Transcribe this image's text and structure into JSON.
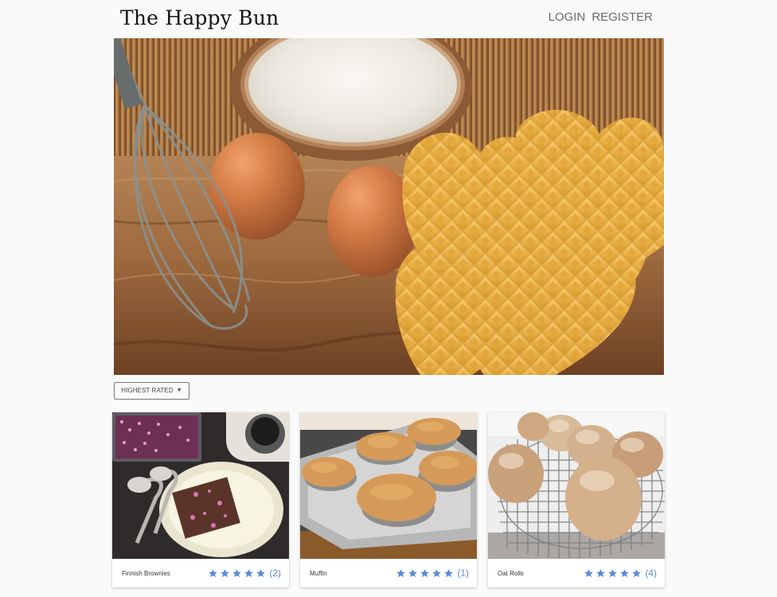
{
  "header": {
    "title": "The Happy Bun",
    "nav": {
      "login": "LOGIN",
      "register": "REGISTER"
    }
  },
  "filters": {
    "sort_label": "HIGHEST RATED"
  },
  "cards": [
    {
      "title": "Finnish Brownies",
      "rating": 5,
      "rating_count": "(2)",
      "image": "brownies-photo"
    },
    {
      "title": "Muffin",
      "rating": 5,
      "rating_count": "(1)",
      "image": "muffin-photo"
    },
    {
      "title": "Oat Rolls",
      "rating": 5,
      "rating_count": "(4)",
      "image": "oat-rolls-photo"
    }
  ],
  "colors": {
    "background": "#fafafa",
    "brand_text": "#141414",
    "nav_text": "#6a6a6a",
    "accent_blue": "#5b8bd8"
  },
  "icons": {
    "sort_caret": "caret-down-icon",
    "rating": "star-icon"
  }
}
